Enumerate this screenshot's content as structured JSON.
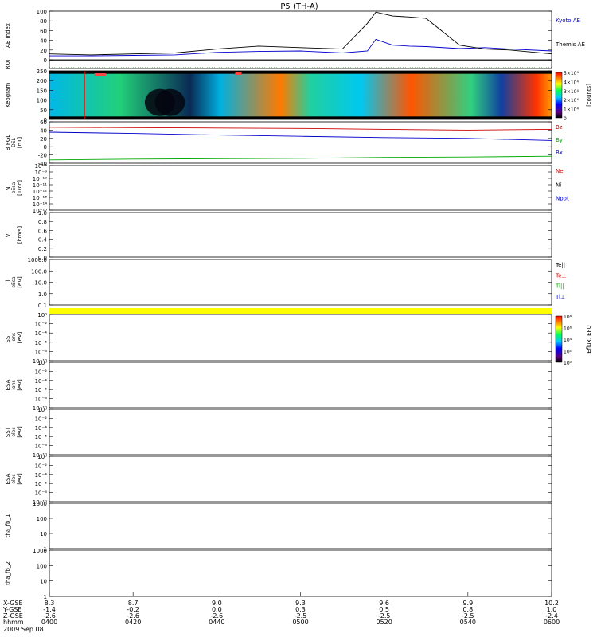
{
  "page": {
    "title": "P5 (TH-A)"
  },
  "time_axis": {
    "ticks": [
      {
        "xgse": "8.3",
        "ygse": "-1.4",
        "zgse": "-2.6",
        "hhmm": "0400"
      },
      {
        "xgse": "8.7",
        "ygse": "-0.2",
        "zgse": "-2.6",
        "hhmm": "0420"
      },
      {
        "xgse": "9.0",
        "ygse": "0.0",
        "zgse": "-2.6",
        "hhmm": "0440"
      },
      {
        "xgse": "9.3",
        "ygse": "0.3",
        "zgse": "-2.5",
        "hhmm": "0500"
      },
      {
        "xgse": "9.6",
        "ygse": "0.5",
        "zgse": "-2.5",
        "hhmm": "0520"
      },
      {
        "xgse": "9.9",
        "ygse": "0.8",
        "zgse": "-2.5",
        "hhmm": "0540"
      },
      {
        "xgse": "10.2",
        "ygse": "1.0",
        "zgse": "-2.4",
        "hhmm": "0600"
      }
    ],
    "row_labels": [
      "X-GSE",
      "Y-GSE",
      "Z-GSE",
      "hhmm"
    ],
    "date_label": "2009 Sep 08"
  },
  "chart_data": [
    {
      "type": "line",
      "panel": "ae",
      "ylabel": "AE Index",
      "yticks": [
        "100",
        "80",
        "60",
        "40",
        "20",
        "0"
      ],
      "ylim": [
        0,
        100
      ],
      "x": [
        "04:00",
        "04:10",
        "04:20",
        "04:30",
        "04:40",
        "04:50",
        "05:00",
        "05:10",
        "05:16",
        "05:18",
        "05:22",
        "05:26",
        "05:30",
        "05:38",
        "05:44",
        "05:50",
        "06:00"
      ],
      "series": [
        {
          "name": "Kyoto AE",
          "color": "#0000cc",
          "values": [
            8,
            8,
            9,
            10,
            15,
            17,
            18,
            14,
            18,
            42,
            30,
            28,
            27,
            23,
            25,
            22,
            18
          ]
        },
        {
          "name": "Themis AE",
          "color": "#000000",
          "values": [
            12,
            10,
            12,
            14,
            22,
            28,
            25,
            22,
            75,
            98,
            90,
            88,
            85,
            30,
            22,
            20,
            12
          ]
        }
      ]
    },
    {
      "type": "line",
      "panel": "roi",
      "ylabel": "ROI",
      "series": [
        {
          "name": "",
          "color": "#006600",
          "values": [
            0,
            0
          ]
        }
      ]
    },
    {
      "type": "heatmap",
      "panel": "keogram",
      "ylabel": "Keogram",
      "yticks": [
        "250",
        "200",
        "150",
        "100",
        "50",
        "0"
      ],
      "ylim": [
        0,
        256
      ],
      "colorbar": {
        "ticks": [
          "5×10⁴",
          "4×10⁴",
          "3×10⁴",
          "2×10⁴",
          "1×10⁴",
          "0"
        ],
        "title": "[counts]",
        "range": [
          0,
          50000
        ]
      }
    },
    {
      "type": "line",
      "panel": "bfgl",
      "ylabel": "B FGL",
      "ylabel_sub": "DSL",
      "units": "[nT]",
      "yticks": [
        "60",
        "40",
        "20",
        "0",
        "-20",
        "-40"
      ],
      "ylim": [
        -40,
        60
      ],
      "x": [
        "04:00",
        "04:20",
        "04:40",
        "05:00",
        "05:20",
        "05:40",
        "06:00"
      ],
      "series": [
        {
          "name": "Bz",
          "color": "#cc0000",
          "values": [
            47,
            46,
            45,
            44,
            42,
            40,
            42
          ]
        },
        {
          "name": "By",
          "color": "#00aa00",
          "values": [
            -32,
            -30,
            -29,
            -28,
            -26,
            -25,
            -23
          ]
        },
        {
          "name": "Bx",
          "color": "#0000cc",
          "values": [
            35,
            32,
            28,
            25,
            22,
            20,
            15
          ]
        }
      ]
    },
    {
      "type": "line",
      "panel": "ni",
      "ylabel": "Ni",
      "ylabel_sub": "eEsa",
      "units": "[1/cc]",
      "yticks": [
        "10⁻⁸",
        "10⁻⁹",
        "10⁻¹⁰",
        "10⁻¹¹",
        "10⁻¹²",
        "10⁻¹³",
        "10⁻¹⁴",
        "10⁻¹⁵"
      ],
      "series": [
        {
          "name": "Ne",
          "color": "#cc0000",
          "values": []
        },
        {
          "name": "Ni",
          "color": "#000000",
          "values": []
        },
        {
          "name": "Npot",
          "color": "#0000cc",
          "values": []
        }
      ]
    },
    {
      "type": "line",
      "panel": "vi",
      "ylabel": "Vi",
      "units": "[km/s]",
      "yticks": [
        "1.0",
        "0.8",
        "0.6",
        "0.4",
        "0.2",
        "0.0"
      ],
      "ylim": [
        0,
        1
      ]
    },
    {
      "type": "line",
      "panel": "ti",
      "ylabel": "Ti",
      "ylabel_sub": "eEsa",
      "units": "[eV]",
      "yticks": [
        "1000.0",
        "100.0",
        "10.0",
        "1.0",
        "0.1"
      ],
      "series": [
        {
          "name": "Te||",
          "color": "#000000",
          "values": []
        },
        {
          "name": "Te⊥",
          "color": "#cc0000",
          "values": []
        },
        {
          "name": "Ti||",
          "color": "#00aa00",
          "values": []
        },
        {
          "name": "Ti⊥",
          "color": "#0000cc",
          "values": []
        }
      ]
    },
    {
      "type": "heatmap",
      "panel": "sst1",
      "ylabel": "SST",
      "ylabel_sub": "ions",
      "units": "[eV]",
      "yticks": [
        "10⁰",
        "10⁻²",
        "10⁻⁴",
        "10⁻⁶",
        "10⁻⁸",
        "10⁻¹⁰"
      ],
      "colorbar": {
        "ticks": [
          "10⁸",
          "10⁶",
          "10⁴",
          "10²",
          "10⁰"
        ],
        "title": "Eflux, EFU"
      }
    },
    {
      "type": "heatmap",
      "panel": "esa1",
      "ylabel": "ESA",
      "ylabel_sub": "ions",
      "units": "[eV]",
      "yticks": [
        "10⁰",
        "10⁻²",
        "10⁻⁴",
        "10⁻⁶",
        "10⁻⁸",
        "10⁻¹⁰"
      ]
    },
    {
      "type": "heatmap",
      "panel": "sst2",
      "ylabel": "SST",
      "ylabel_sub": "elec",
      "units": "[eV]",
      "yticks": [
        "10⁰",
        "10⁻²",
        "10⁻⁴",
        "10⁻⁶",
        "10⁻⁸",
        "10⁻¹⁰"
      ]
    },
    {
      "type": "heatmap",
      "panel": "esa2",
      "ylabel": "ESA",
      "ylabel_sub": "elec",
      "units": "[eV]",
      "yticks": [
        "10⁰",
        "10⁻²",
        "10⁻⁴",
        "10⁻⁶",
        "10⁻⁸",
        "10⁻¹⁰"
      ]
    },
    {
      "type": "line",
      "panel": "fb1",
      "ylabel": "tha_fb_1",
      "yticks": [
        "1000",
        "100",
        "10",
        "1"
      ]
    },
    {
      "type": "line",
      "panel": "fb2",
      "ylabel": "tha_fb_2",
      "yticks": [
        "1000",
        "100",
        "10",
        "1"
      ]
    }
  ]
}
